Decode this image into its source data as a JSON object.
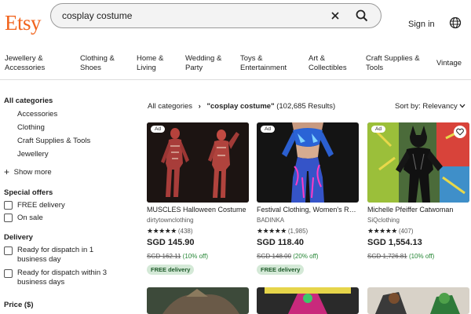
{
  "brand": {
    "logo": "Etsy"
  },
  "search": {
    "value": "cosplay costume"
  },
  "header": {
    "sign_in": "Sign in"
  },
  "nav": [
    {
      "line1": "Jewellery &",
      "line2": "Accessories"
    },
    {
      "line1": "Clothing &",
      "line2": "Shoes"
    },
    {
      "line1": "Home &",
      "line2": "Living"
    },
    {
      "line1": "Wedding &",
      "line2": "Party"
    },
    {
      "line1": "Toys &",
      "line2": "Entertainment"
    },
    {
      "line1": "Art &",
      "line2": "Collectibles"
    },
    {
      "line1": "Craft Supplies &",
      "line2": "Tools"
    },
    {
      "line1": "Vintage",
      "line2": ""
    }
  ],
  "sidebar": {
    "all_categories": "All categories",
    "categories": [
      "Accessories",
      "Clothing",
      "Craft Supplies & Tools",
      "Jewellery"
    ],
    "show_more": "Show more",
    "special_offers": "Special offers",
    "offers": [
      "FREE delivery",
      "On sale"
    ],
    "delivery": "Delivery",
    "dispatch_1": {
      "line1": "Ready for dispatch in 1",
      "line2": "business day"
    },
    "dispatch_3": {
      "line1": "Ready for dispatch within 3",
      "line2": "business days"
    },
    "price": "Price ($)"
  },
  "results": {
    "crumb_all": "All categories",
    "crumb_query": "\"cosplay costume\"",
    "crumb_count": "(102,685 Results)",
    "sort_label": "Sort by: Relevancy"
  },
  "products": [
    {
      "ad": "Ad",
      "title": "MUSCLES Halloween Costume",
      "shop": "dirtytownclothing",
      "stars": "★★★★★",
      "reviews": "(438)",
      "price": "SGD 145.90",
      "original": "SGD 162.11",
      "discount": "(10% off)",
      "free": "FREE delivery"
    },
    {
      "ad": "Ad",
      "title": "Festival Clothing, Women's Rave",
      "shop": "BADINKA",
      "stars": "★★★★★",
      "reviews": "(1,985)",
      "price": "SGD 118.40",
      "original": "SGD 148.00",
      "discount": "(20% off)",
      "free": "FREE delivery"
    },
    {
      "ad": "Ad",
      "title": "Michelle Pfeiffer Catwoman",
      "shop": "SiQclothing",
      "stars": "★★★★★",
      "reviews": "(407)",
      "price": "SGD 1,554.13",
      "original": "SGD 1,726.81",
      "discount": "(10% off)"
    }
  ],
  "colors": {
    "brand": "#f1641e",
    "free_bg": "#d4e9d7",
    "discount": "#258635"
  }
}
